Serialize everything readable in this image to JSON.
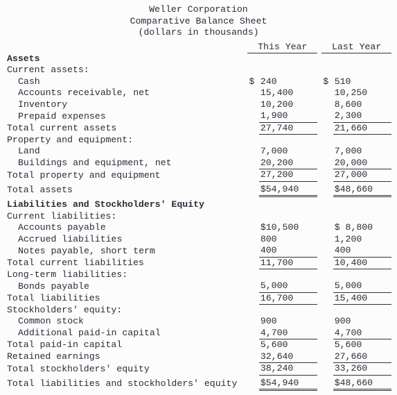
{
  "chart_data": {
    "type": "table",
    "title": "Weller Corporation — Comparative Balance Sheet (dollars in thousands)",
    "columns": [
      "This Year",
      "Last Year"
    ],
    "rows": [
      {
        "label": "Cash",
        "values": [
          240,
          510
        ]
      },
      {
        "label": "Accounts receivable, net",
        "values": [
          15400,
          10250
        ]
      },
      {
        "label": "Inventory",
        "values": [
          10200,
          8600
        ]
      },
      {
        "label": "Prepaid expenses",
        "values": [
          1900,
          2300
        ]
      },
      {
        "label": "Total current assets",
        "values": [
          27740,
          21660
        ]
      },
      {
        "label": "Land",
        "values": [
          7000,
          7000
        ]
      },
      {
        "label": "Buildings and equipment, net",
        "values": [
          20200,
          20000
        ]
      },
      {
        "label": "Total property and equipment",
        "values": [
          27200,
          27000
        ]
      },
      {
        "label": "Total assets",
        "values": [
          54940,
          48660
        ]
      },
      {
        "label": "Accounts payable",
        "values": [
          10500,
          8800
        ]
      },
      {
        "label": "Accrued liabilities",
        "values": [
          800,
          1200
        ]
      },
      {
        "label": "Notes payable, short term",
        "values": [
          400,
          400
        ]
      },
      {
        "label": "Total current liabilities",
        "values": [
          11700,
          10400
        ]
      },
      {
        "label": "Bonds payable",
        "values": [
          5000,
          5000
        ]
      },
      {
        "label": "Total liabilities",
        "values": [
          16700,
          15400
        ]
      },
      {
        "label": "Common stock",
        "values": [
          900,
          900
        ]
      },
      {
        "label": "Additional paid-in capital",
        "values": [
          4700,
          4700
        ]
      },
      {
        "label": "Total paid-in capital",
        "values": [
          5600,
          5600
        ]
      },
      {
        "label": "Retained earnings",
        "values": [
          32640,
          27660
        ]
      },
      {
        "label": "Total stockholders' equity",
        "values": [
          38240,
          33260
        ]
      },
      {
        "label": "Total liabilities and stockholders' equity",
        "values": [
          54940,
          48660
        ]
      }
    ]
  },
  "title": {
    "company": "Weller Corporation",
    "doc": "Comparative Balance Sheet",
    "units": "(dollars in thousands)"
  },
  "col": {
    "c1": "This Year",
    "c2": "Last Year"
  },
  "sec": {
    "assets": "Assets",
    "cur_assets": "Current assets:",
    "ppe": "Property and equipment:",
    "liab": "Liabilities and Stockholders' Equity",
    "cur_liab": "Current liabilities:",
    "lt_liab": "Long-term liabilities:",
    "se": "Stockholders' equity:"
  },
  "row": {
    "cash": {
      "l": "Cash",
      "y1": "240",
      "y2": "510",
      "s1": "$",
      "s2": "$"
    },
    "ar": {
      "l": "Accounts receivable, net",
      "y1": "15,400",
      "y2": "10,250"
    },
    "inv": {
      "l": "Inventory",
      "y1": "10,200",
      "y2": "8,600"
    },
    "ppx": {
      "l": "Prepaid expenses",
      "y1": "1,900",
      "y2": "2,300"
    },
    "tca": {
      "l": "Total current assets",
      "y1": "27,740",
      "y2": "21,660"
    },
    "land": {
      "l": "Land",
      "y1": "7,000",
      "y2": "7,000"
    },
    "bldg": {
      "l": "Buildings and equipment, net",
      "y1": "20,200",
      "y2": "20,000"
    },
    "tppe": {
      "l": "Total property and equipment",
      "y1": "27,200",
      "y2": "27,000"
    },
    "ta": {
      "l": "Total assets",
      "y1": "$54,940",
      "y2": "$48,660"
    },
    "ap": {
      "l": "Accounts payable",
      "y1": "$10,500",
      "y2": "$ 8,800"
    },
    "accr": {
      "l": "Accrued liabilities",
      "y1": "800",
      "y2": "1,200"
    },
    "np": {
      "l": "Notes payable, short term",
      "y1": "400",
      "y2": "400"
    },
    "tcl": {
      "l": "Total current liabilities",
      "y1": "11,700",
      "y2": "10,400"
    },
    "bonds": {
      "l": "Bonds payable",
      "y1": "5,000",
      "y2": "5,000"
    },
    "tl": {
      "l": "Total liabilities",
      "y1": "16,700",
      "y2": "15,400"
    },
    "cs": {
      "l": "Common stock",
      "y1": "900",
      "y2": "900"
    },
    "apic": {
      "l": "Additional paid-in capital",
      "y1": "4,700",
      "y2": "4,700"
    },
    "tpic": {
      "l": "Total paid-in capital",
      "y1": "5,600",
      "y2": "5,600"
    },
    "re": {
      "l": "Retained earnings",
      "y1": "32,640",
      "y2": "27,660"
    },
    "tse": {
      "l": "Total stockholders' equity",
      "y1": "38,240",
      "y2": "33,260"
    },
    "tlse": {
      "l": "Total liabilities and stockholders' equity",
      "y1": "$54,940",
      "y2": "$48,660"
    }
  }
}
